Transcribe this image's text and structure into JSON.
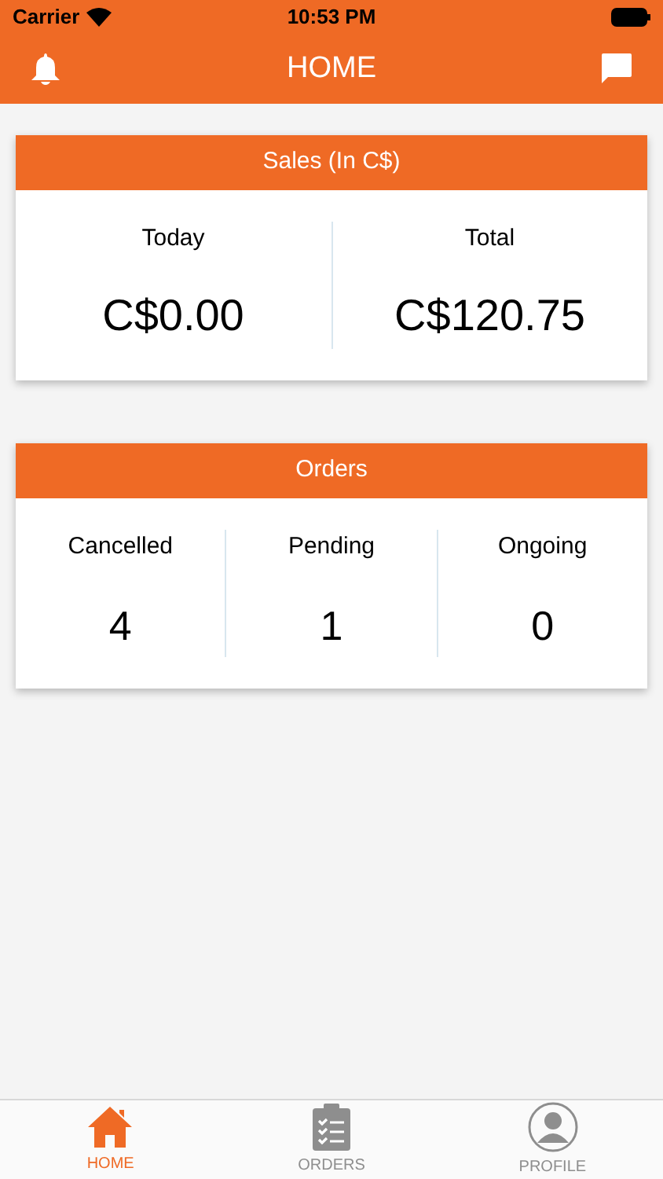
{
  "status_bar": {
    "carrier": "Carrier",
    "time": "10:53 PM"
  },
  "nav": {
    "title": "HOME"
  },
  "sales": {
    "title": "Sales (In C$)",
    "stats": [
      {
        "label": "Today",
        "value": "C$0.00"
      },
      {
        "label": "Total",
        "value": "C$120.75"
      }
    ]
  },
  "orders": {
    "title": "Orders",
    "stats": [
      {
        "label": "Cancelled",
        "value": "4"
      },
      {
        "label": "Pending",
        "value": "1"
      },
      {
        "label": "Ongoing",
        "value": "0"
      }
    ]
  },
  "tab_bar": [
    {
      "kind": "home",
      "label": "HOME",
      "selected": true
    },
    {
      "kind": "orders",
      "label": "ORDERS",
      "selected": false
    },
    {
      "kind": "profile",
      "label": "PROFILE",
      "selected": false
    }
  ]
}
